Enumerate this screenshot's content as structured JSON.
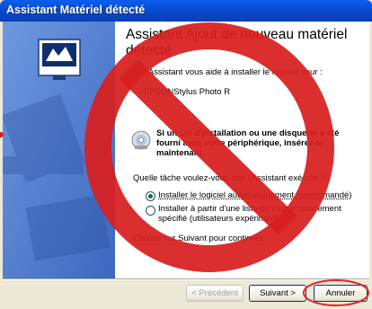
{
  "window": {
    "title": "Assistant Matériel détecté"
  },
  "content": {
    "heading": "Assistant Ajout de nouveau matériel détecté",
    "intro": "Cet Assistant vous aide à installer le logiciel pour :",
    "device_name": "EPSONStylus Photo R",
    "cd_hint": "Si un CD d'installation ou une disquette a été fourni avec votre périphérique, insérez-le maintenant.",
    "question": "Quelle tâche voulez-vous que l'Assistant exécute ?",
    "options": [
      {
        "label": "Installer le logiciel automatiquement (recommandé)",
        "selected": true
      },
      {
        "label": "Installer à partir d'une liste ou d'un emplacement spécifié (utilisateurs expérimentés)",
        "selected": false
      }
    ],
    "continue_hint": "Cliquez sur Suivant pour continuer."
  },
  "buttons": {
    "back": "< Précédent",
    "next": "Suivant >",
    "cancel": "Annuler"
  },
  "overlay": {
    "prohibition_color": "#d81e1e",
    "circle_color": "#e0262b"
  }
}
